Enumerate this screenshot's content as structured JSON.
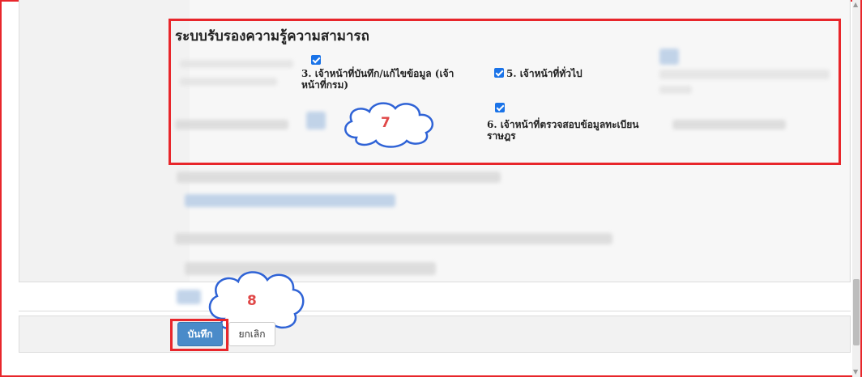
{
  "section": {
    "title": "ระบบรับรองความรู้ความสามารถ"
  },
  "options": [
    {
      "label_line1": "3. เจ้าหน้าที่บันทึก/แก้ไขข้อมูล (เจ้า",
      "label_line2": "หน้าที่กรม)",
      "checked": true
    },
    {
      "label_line1": "5. เจ้าหน้าที่ทั่วไป",
      "checked": true
    },
    {
      "label_line1": "6. เจ้าหน้าที่ตรวจสอบข้อมูลทะเบียน",
      "label_line2": "ราษฎร",
      "checked": true
    }
  ],
  "callouts": {
    "step7": "7",
    "step8": "8"
  },
  "buttons": {
    "save": "บันทึก",
    "cancel": "ยกเลิก"
  },
  "colors": {
    "highlight": "#e8262b",
    "primary_button": "#4a8bc9",
    "checkbox": "#1a73e8",
    "callout_text": "#e04848"
  }
}
